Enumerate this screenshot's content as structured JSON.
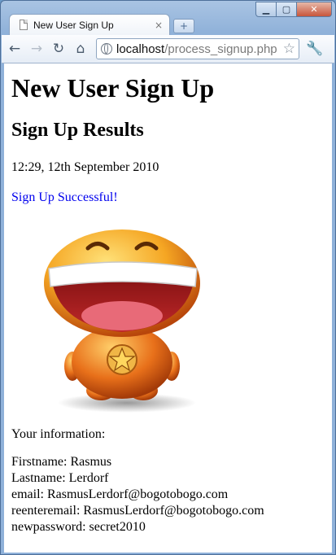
{
  "browser": {
    "tab_title": "New User Sign Up",
    "tab_close": "×",
    "new_tab": "+",
    "url_host": "localhost",
    "url_path": "/process_signup.php",
    "controls": {
      "minimize": "▁",
      "maximize": "▢",
      "close": "✕"
    },
    "nav": {
      "back": "←",
      "forward": "→",
      "reload": "↻",
      "home": "⌂",
      "star": "☆",
      "wrench": "🔧"
    }
  },
  "page": {
    "title": "New User Sign Up",
    "subtitle": "Sign Up Results",
    "timestamp": "12:29, 12th September 2010",
    "status": "Sign Up Successful!",
    "info_heading": "Your information:",
    "fields": [
      "Firstname: Rasmus",
      "Lastname: Lerdorf",
      "email: RasmusLerdorf@bogotobogo.com",
      "reenteremail: RasmusLerdorf@bogotobogo.com",
      "newpassword: secret2010"
    ]
  }
}
